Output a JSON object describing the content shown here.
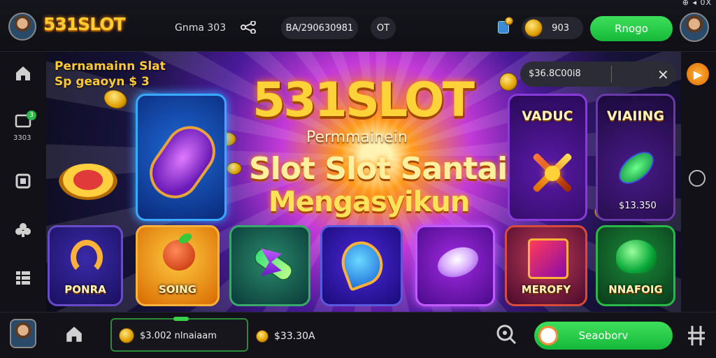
{
  "status_corner": "⊕ ◂ 0X",
  "header": {
    "logo": "531SLOT",
    "game_label": "Gnma 303",
    "id_pill": "BA/290630981",
    "small_pill": "OT",
    "coin_balance": "903",
    "action_button": "Rnogo"
  },
  "sidebar": {
    "badge": "3",
    "label": "3303"
  },
  "promo": {
    "line1": "Pernamainn Slat",
    "line2": "Sp geaoyn $ 3"
  },
  "hero": {
    "title": "531SLOT",
    "small": "Permmainein",
    "line1": "Slot Slot Santai",
    "line2": "Mengasyikun"
  },
  "search": {
    "value": "$36.8C00i8"
  },
  "tiles": {
    "vaduc": "VADUC",
    "viaiing": "VIAIING",
    "amount": "$13.350",
    "ponra": "PONRA",
    "soing": "SOING",
    "merofy": "MEROFY",
    "nnafoig": "NNAFOIG"
  },
  "footer": {
    "input_text": "$3.002 nlnaiaam",
    "balance": "$33.30A",
    "action_button": "Seaoborv"
  },
  "colors": {
    "accent_green": "#1fc840",
    "gold": "#ffd23a",
    "purple": "#7a2ad8"
  }
}
